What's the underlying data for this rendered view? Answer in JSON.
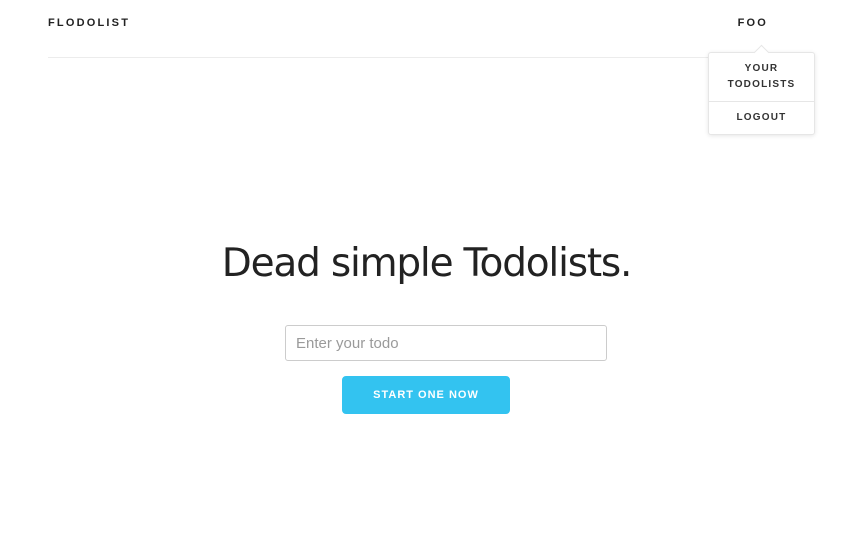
{
  "navbar": {
    "brand": "FLODOLIST",
    "user_menu_label": "FOO"
  },
  "dropdown": {
    "items": [
      {
        "label": "YOUR TODOLISTS"
      },
      {
        "label": "LOGOUT"
      }
    ]
  },
  "hero": {
    "title": "Dead simple Todolists."
  },
  "todo_form": {
    "input_value": "",
    "input_placeholder": "Enter your todo",
    "submit_label": "START ONE NOW"
  },
  "colors": {
    "accent": "#33c3f0",
    "text": "#222222",
    "border": "#cccccc",
    "divider": "#ececec"
  }
}
